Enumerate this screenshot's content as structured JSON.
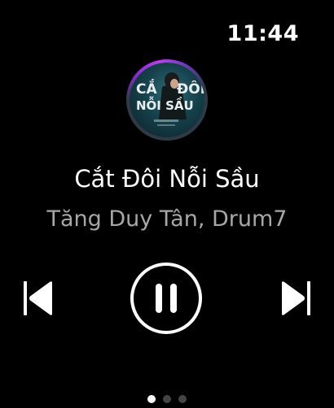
{
  "status_bar": {
    "time": "11:44"
  },
  "now_playing": {
    "title": "Cắt Đôi Nỗi Sầu",
    "artist": "Tăng Duy Tân, Drum7",
    "artwork_text": "CẮT ĐÔI NỖI SẦU",
    "state": "playing"
  },
  "controls": {
    "previous_icon": "backward-skip-icon",
    "play_pause_icon": "pause-icon",
    "next_icon": "forward-skip-icon"
  },
  "pagination": {
    "pages": 3,
    "current": 1
  },
  "colors": {
    "background": "#000000",
    "text_primary": "#ffffff",
    "text_secondary": "#a7a7a7",
    "ring_accent": "#c13cf0",
    "dot_inactive": "#444444"
  }
}
